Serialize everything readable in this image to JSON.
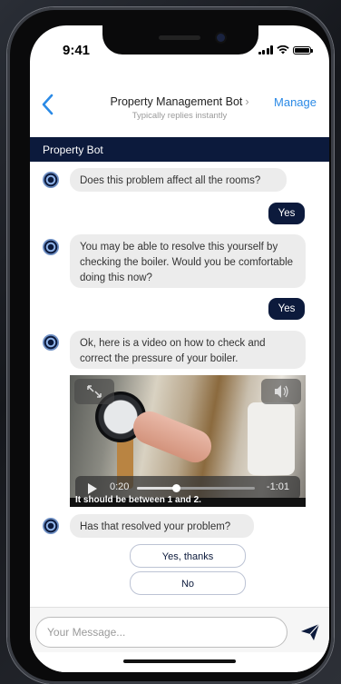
{
  "status_bar": {
    "time": "9:41"
  },
  "nav": {
    "title": "Property Management Bot",
    "chevron": "›",
    "subtitle": "Typically replies instantly",
    "manage_label": "Manage",
    "back_icon": "chevron-left-icon"
  },
  "bot_header": {
    "name": "Property Bot"
  },
  "messages": [
    {
      "from": "bot",
      "text": "Does this problem affect all the rooms?"
    },
    {
      "from": "user",
      "text": "Yes"
    },
    {
      "from": "bot",
      "text": "You may be able to resolve this yourself by checking the boiler. Would you be comfortable doing this now?"
    },
    {
      "from": "user",
      "text": "Yes"
    },
    {
      "from": "bot",
      "text": "Ok, here is a video on how to check and correct the pressure of your boiler."
    },
    {
      "from": "bot",
      "text": "Has that resolved your problem?"
    }
  ],
  "video": {
    "caption": "It should be between 1 and 2.",
    "current_time": "0:20",
    "remaining_time": "-1:01",
    "progress": 0.33
  },
  "quick_replies": [
    "Yes, thanks",
    "No"
  ],
  "composer": {
    "placeholder": "Your Message...",
    "send_icon": "send-icon"
  },
  "colors": {
    "brand_navy": "#0c1a3c",
    "link_blue": "#2b8ae6",
    "bubble_gray": "#ececec"
  }
}
